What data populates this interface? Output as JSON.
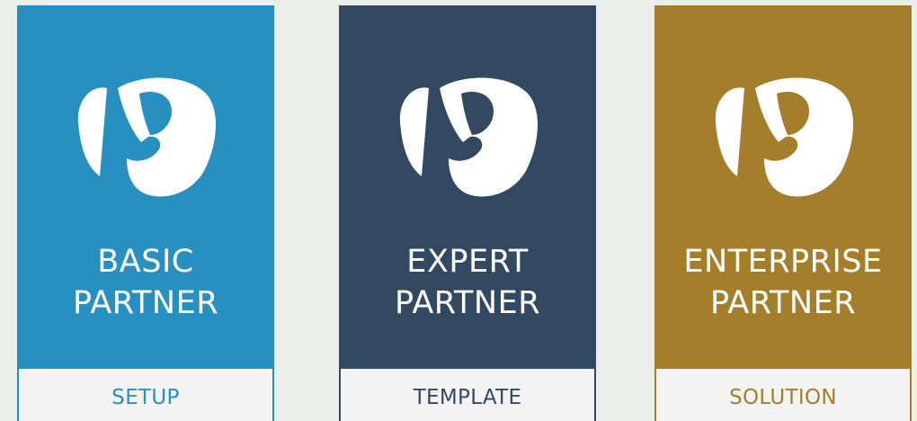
{
  "badges": [
    {
      "title_line1": "BASIC",
      "title_line2": "PARTNER",
      "footer": "SETUP",
      "color": "#2790c0",
      "footer_text_color": "#2790c0"
    },
    {
      "title_line1": "EXPERT",
      "title_line2": "PARTNER",
      "footer": "TEMPLATE",
      "color": "#334962",
      "footer_text_color": "#334962"
    },
    {
      "title_line1": "ENTERPRISE",
      "title_line2": "PARTNER",
      "footer": "SOLUTION",
      "color": "#a47e2b",
      "footer_text_color": "#a47e2b"
    }
  ],
  "logo_icon": "p-logo-icon"
}
